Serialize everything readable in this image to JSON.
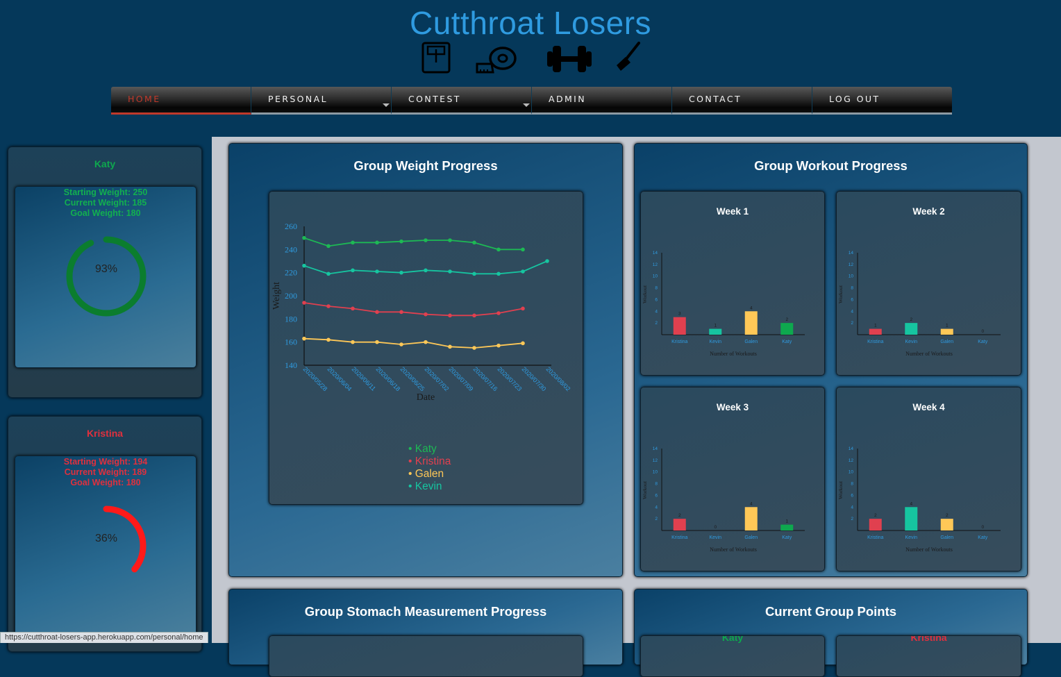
{
  "header": {
    "title": "Cutthroat Losers",
    "icons": [
      "scale-icon",
      "tape-measure-icon",
      "dumbbell-icon",
      "knife-icon"
    ]
  },
  "nav": {
    "items": [
      {
        "label": "HOME",
        "active": true,
        "dropdown": false
      },
      {
        "label": "PERSONAL",
        "active": false,
        "dropdown": true
      },
      {
        "label": "CONTEST",
        "active": false,
        "dropdown": true
      },
      {
        "label": "ADMIN",
        "active": false,
        "dropdown": false
      },
      {
        "label": "CONTACT",
        "active": false,
        "dropdown": false
      },
      {
        "label": "LOG OUT",
        "active": false,
        "dropdown": false
      }
    ]
  },
  "sidebar": {
    "users": [
      {
        "name": "Katy",
        "color": "#0ea84e",
        "ring_color": "#0b7d2e",
        "starting": "Starting Weight: 250",
        "current": "Current Weight: 185",
        "goal": "Goal Weight: 180",
        "percent_label": "93%",
        "percent": 0.93
      },
      {
        "name": "Kristina",
        "color": "#e0303e",
        "ring_color": "#ff1a1a",
        "starting": "Starting Weight: 194",
        "current": "Current Weight: 189",
        "goal": "Goal Weight: 180",
        "percent_label": "36%",
        "percent": 0.36
      }
    ]
  },
  "panels": {
    "weight_title": "Group Weight Progress",
    "workout_title": "Group Workout Progress",
    "stomach_title": "Group Stomach Measurement Progress",
    "points_title": "Current Group Points",
    "points_names": [
      {
        "name": "Katy",
        "color": "#0ea84e"
      },
      {
        "name": "Kristina",
        "color": "#e0303e"
      }
    ]
  },
  "status_bar": {
    "url": "https://cutthroat-losers-app.herokuapp.com/personal/home"
  },
  "chart_data": [
    {
      "type": "line",
      "title": "",
      "xlabel": "Date",
      "ylabel": "Weight",
      "ylim": [
        140,
        260
      ],
      "yticks": [
        140,
        160,
        180,
        200,
        220,
        240,
        260
      ],
      "x": [
        "2020/05/28",
        "2020/06/04",
        "2020/06/11",
        "2020/06/18",
        "2020/06/25",
        "2020/07/02",
        "2020/07/09",
        "2020/07/16",
        "2020/07/23",
        "2020/07/30",
        "2020/08/02"
      ],
      "series": [
        {
          "name": "Katy",
          "color": "#1db954",
          "values": [
            250,
            243,
            246,
            246,
            247,
            248,
            248,
            246,
            240,
            240,
            null
          ]
        },
        {
          "name": "Kristina",
          "color": "#e0404f",
          "values": [
            194,
            191,
            189,
            186,
            186,
            184,
            183,
            183,
            185,
            189,
            null
          ]
        },
        {
          "name": "Galen",
          "color": "#ffc857",
          "values": [
            163,
            162,
            160,
            160,
            158,
            160,
            156,
            155,
            157,
            159,
            null
          ]
        },
        {
          "name": "Kevin",
          "color": "#16c5a0",
          "values": [
            226,
            219,
            222,
            221,
            220,
            222,
            221,
            219,
            219,
            221,
            230
          ]
        }
      ],
      "legend_position": "bottom"
    },
    {
      "type": "bar",
      "title": "Week 1",
      "xlabel": "Number of Workouts",
      "ylabel": "Workout",
      "ylim": [
        0,
        14
      ],
      "yticks": [
        2,
        4,
        6,
        8,
        10,
        12,
        14
      ],
      "categories": [
        "Kristina",
        "Kevin",
        "Galen",
        "Katy"
      ],
      "values": [
        3,
        1,
        4,
        2
      ],
      "colors": [
        "#e0404f",
        "#16c5a0",
        "#ffc857",
        "#0ea84e"
      ]
    },
    {
      "type": "bar",
      "title": "Week 2",
      "xlabel": "Number of Workouts",
      "ylabel": "Workout",
      "ylim": [
        0,
        14
      ],
      "yticks": [
        2,
        4,
        6,
        8,
        10,
        12,
        14
      ],
      "categories": [
        "Kristina",
        "Kevin",
        "Galen",
        "Katy"
      ],
      "values": [
        1,
        2,
        1,
        0
      ],
      "colors": [
        "#e0404f",
        "#16c5a0",
        "#ffc857",
        "#0ea84e"
      ]
    },
    {
      "type": "bar",
      "title": "Week 3",
      "xlabel": "Number of Workouts",
      "ylabel": "Workout",
      "ylim": [
        0,
        14
      ],
      "yticks": [
        2,
        4,
        6,
        8,
        10,
        12,
        14
      ],
      "categories": [
        "Kristina",
        "Kevin",
        "Galen",
        "Katy"
      ],
      "values": [
        2,
        0,
        4,
        1
      ],
      "colors": [
        "#e0404f",
        "#16c5a0",
        "#ffc857",
        "#0ea84e"
      ]
    },
    {
      "type": "bar",
      "title": "Week 4",
      "xlabel": "Number of Workouts",
      "ylabel": "Workout",
      "ylim": [
        0,
        14
      ],
      "yticks": [
        2,
        4,
        6,
        8,
        10,
        12,
        14
      ],
      "categories": [
        "Kristina",
        "Kevin",
        "Galen",
        "Katy"
      ],
      "values": [
        2,
        4,
        2,
        0
      ],
      "colors": [
        "#e0404f",
        "#16c5a0",
        "#ffc857",
        "#0ea84e"
      ]
    }
  ]
}
